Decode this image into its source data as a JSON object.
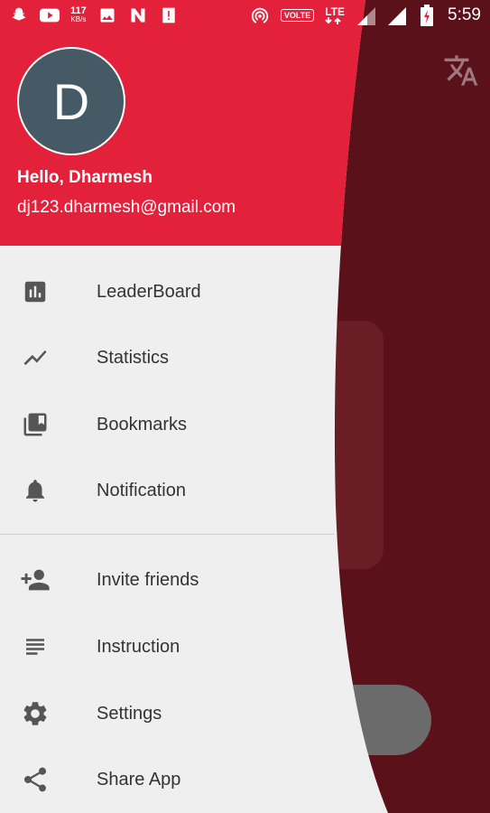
{
  "status_bar": {
    "speed_value": "117",
    "speed_unit": "KB/s",
    "volte": "VOLTE",
    "network": "LTE",
    "time": "5:59"
  },
  "user": {
    "avatar_letter": "D",
    "greeting": "Hello, Dharmesh",
    "email": "dj123.dharmesh@gmail.com"
  },
  "menu": {
    "items": [
      {
        "label": "LeaderBoard",
        "icon": "leaderboard-icon"
      },
      {
        "label": "Statistics",
        "icon": "trending-icon"
      },
      {
        "label": "Bookmarks",
        "icon": "bookmarks-icon"
      },
      {
        "label": "Notification",
        "icon": "bell-icon"
      },
      {
        "label": "Invite friends",
        "icon": "person-add-icon"
      },
      {
        "label": "Instruction",
        "icon": "list-icon"
      },
      {
        "label": "Settings",
        "icon": "gear-icon"
      },
      {
        "label": "Share App",
        "icon": "share-icon"
      }
    ]
  },
  "colors": {
    "header": "#e3213b",
    "avatar": "#455a64",
    "drawer_bg": "#efefef",
    "scrim": "#5b1119"
  }
}
